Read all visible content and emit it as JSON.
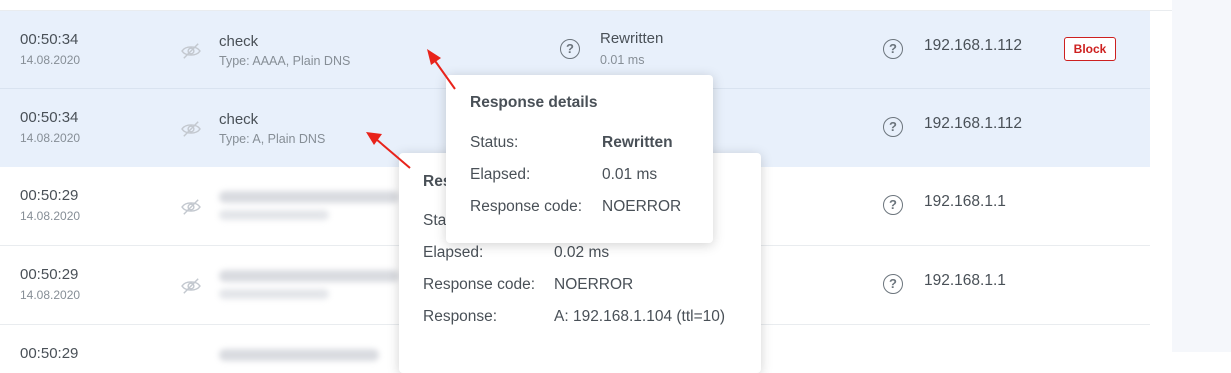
{
  "rows": [
    {
      "time": "00:50:34",
      "date": "14.08.2020",
      "domain": "check",
      "type": "Type: AAAA, Plain DNS",
      "response_status": "Rewritten",
      "response_elapsed": "0.01 ms",
      "client": "192.168.1.112",
      "action": "Block"
    },
    {
      "time": "00:50:34",
      "date": "14.08.2020",
      "domain": "check",
      "type": "Type: A, Plain DNS",
      "client": "192.168.1.112"
    },
    {
      "time": "00:50:29",
      "date": "14.08.2020",
      "client": "192.168.1.1"
    },
    {
      "time": "00:50:29",
      "date": "14.08.2020",
      "client": "192.168.1.1"
    },
    {
      "time": "00:50:29"
    }
  ],
  "popup_front": {
    "title": "Response details",
    "status_label": "Status:",
    "status_value": "Rewritten",
    "elapsed_label": "Elapsed:",
    "elapsed_value": "0.01 ms",
    "code_label": "Response code:",
    "code_value": "NOERROR"
  },
  "popup_back": {
    "title_partial": "Res",
    "status_label_partial": "Stat",
    "elapsed_label": "Elapsed:",
    "elapsed_value": "0.02 ms",
    "code_label": "Response code:",
    "code_value": "NOERROR",
    "response_label": "Response:",
    "response_value": "A: 192.168.1.104 (ttl=10)"
  },
  "icons": {
    "hidden_eye": "eye-slash-icon",
    "help": "question-circle-icon",
    "help_glyph": "?"
  },
  "colors": {
    "highlight_row": "#e8f0fb",
    "block_red": "#cd201f",
    "arrow_red": "#e8231b"
  }
}
